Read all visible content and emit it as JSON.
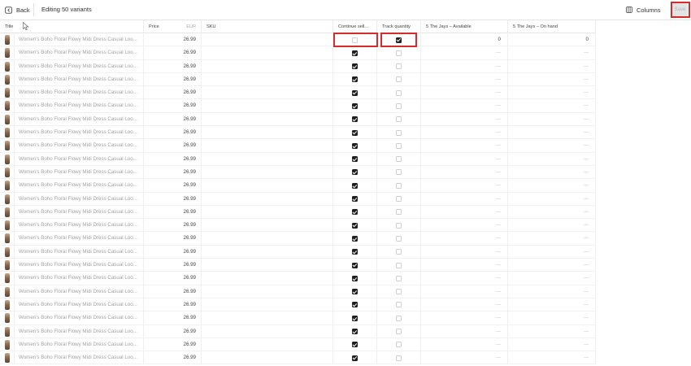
{
  "toolbar": {
    "back_label": "Back",
    "title": "Editing 50 variants",
    "columns_label": "Columns",
    "save_label": "Save"
  },
  "table": {
    "headers": {
      "title": "Title",
      "price": "Price",
      "currency": "EUR",
      "sku": "SKU",
      "continue_selling": "Continue sell...",
      "track_quantity": "Track quantity",
      "available": "5 The Jays – Available",
      "on_hand": "5 The Jays – On hand"
    },
    "rows": [
      {
        "title": "Women's Boho Floral Flowy Midi Dress Casual Loo...",
        "price": "26.99",
        "sku": "",
        "continue_selling": false,
        "track_quantity": true,
        "available": "0",
        "on_hand": "0"
      },
      {
        "title": "Women's Boho Floral Flowy Midi Dress Casual Loo...",
        "price": "26.99",
        "sku": "",
        "continue_selling": true,
        "track_quantity": false,
        "available": "—",
        "on_hand": "—"
      },
      {
        "title": "Women's Boho Floral Flowy Midi Dress Casual Loo...",
        "price": "26.99",
        "sku": "",
        "continue_selling": true,
        "track_quantity": false,
        "available": "—",
        "on_hand": "—"
      },
      {
        "title": "Women's Boho Floral Flowy Midi Dress Casual Loo...",
        "price": "26.99",
        "sku": "",
        "continue_selling": true,
        "track_quantity": false,
        "available": "—",
        "on_hand": "—"
      },
      {
        "title": "Women's Boho Floral Flowy Midi Dress Casual Loo...",
        "price": "26.99",
        "sku": "",
        "continue_selling": true,
        "track_quantity": false,
        "available": "—",
        "on_hand": "—"
      },
      {
        "title": "Women's Boho Floral Flowy Midi Dress Casual Loo...",
        "price": "26.99",
        "sku": "",
        "continue_selling": true,
        "track_quantity": false,
        "available": "—",
        "on_hand": "—"
      },
      {
        "title": "Women's Boho Floral Flowy Midi Dress Casual Loo...",
        "price": "26.99",
        "sku": "",
        "continue_selling": true,
        "track_quantity": false,
        "available": "—",
        "on_hand": "—"
      },
      {
        "title": "Women's Boho Floral Flowy Midi Dress Casual Loo...",
        "price": "26.99",
        "sku": "",
        "continue_selling": true,
        "track_quantity": false,
        "available": "—",
        "on_hand": "—"
      },
      {
        "title": "Women's Boho Floral Flowy Midi Dress Casual Loo...",
        "price": "26.99",
        "sku": "",
        "continue_selling": true,
        "track_quantity": false,
        "available": "—",
        "on_hand": "—"
      },
      {
        "title": "Women's Boho Floral Flowy Midi Dress Casual Loo...",
        "price": "26.99",
        "sku": "",
        "continue_selling": true,
        "track_quantity": false,
        "available": "—",
        "on_hand": "—"
      },
      {
        "title": "Women's Boho Floral Flowy Midi Dress Casual Loo...",
        "price": "26.99",
        "sku": "",
        "continue_selling": true,
        "track_quantity": false,
        "available": "—",
        "on_hand": "—"
      },
      {
        "title": "Women's Boho Floral Flowy Midi Dress Casual Loo...",
        "price": "26.99",
        "sku": "",
        "continue_selling": true,
        "track_quantity": false,
        "available": "—",
        "on_hand": "—"
      },
      {
        "title": "Women's Boho Floral Flowy Midi Dress Casual Loo...",
        "price": "26.99",
        "sku": "",
        "continue_selling": true,
        "track_quantity": false,
        "available": "—",
        "on_hand": "—"
      },
      {
        "title": "Women's Boho Floral Flowy Midi Dress Casual Loo...",
        "price": "26.99",
        "sku": "",
        "continue_selling": true,
        "track_quantity": false,
        "available": "—",
        "on_hand": "—"
      },
      {
        "title": "Women's Boho Floral Flowy Midi Dress Casual Loo...",
        "price": "26.99",
        "sku": "",
        "continue_selling": true,
        "track_quantity": false,
        "available": "—",
        "on_hand": "—"
      },
      {
        "title": "Women's Boho Floral Flowy Midi Dress Casual Loo...",
        "price": "26.99",
        "sku": "",
        "continue_selling": true,
        "track_quantity": false,
        "available": "—",
        "on_hand": "—"
      },
      {
        "title": "Women's Boho Floral Flowy Midi Dress Casual Loo...",
        "price": "26.99",
        "sku": "",
        "continue_selling": true,
        "track_quantity": false,
        "available": "—",
        "on_hand": "—"
      },
      {
        "title": "Women's Boho Floral Flowy Midi Dress Casual Loo...",
        "price": "26.99",
        "sku": "",
        "continue_selling": true,
        "track_quantity": false,
        "available": "—",
        "on_hand": "—"
      },
      {
        "title": "Women's Boho Floral Flowy Midi Dress Casual Loo...",
        "price": "26.99",
        "sku": "",
        "continue_selling": true,
        "track_quantity": false,
        "available": "—",
        "on_hand": "—"
      },
      {
        "title": "Women's Boho Floral Flowy Midi Dress Casual Loo...",
        "price": "26.99",
        "sku": "",
        "continue_selling": true,
        "track_quantity": false,
        "available": "—",
        "on_hand": "—"
      },
      {
        "title": "Women's Boho Floral Flowy Midi Dress Casual Loo...",
        "price": "26.99",
        "sku": "",
        "continue_selling": true,
        "track_quantity": false,
        "available": "—",
        "on_hand": "—"
      },
      {
        "title": "Women's Boho Floral Flowy Midi Dress Casual Loo...",
        "price": "26.99",
        "sku": "",
        "continue_selling": true,
        "track_quantity": false,
        "available": "—",
        "on_hand": "—"
      },
      {
        "title": "Women's Boho Floral Flowy Midi Dress Casual Loo...",
        "price": "26.99",
        "sku": "",
        "continue_selling": true,
        "track_quantity": false,
        "available": "—",
        "on_hand": "—"
      },
      {
        "title": "Women's Boho Floral Flowy Midi Dress Casual Loo...",
        "price": "26.99",
        "sku": "",
        "continue_selling": true,
        "track_quantity": false,
        "available": "—",
        "on_hand": "—"
      },
      {
        "title": "Women's Boho Floral Flowy Midi Dress Casual Loo...",
        "price": "26.99",
        "sku": "",
        "continue_selling": true,
        "track_quantity": false,
        "available": "—",
        "on_hand": "—"
      }
    ]
  },
  "colors": {
    "highlight": "#d62b2b",
    "checkbox_checked": "#1f1f1f",
    "muted_text": "#a2a2a2"
  }
}
